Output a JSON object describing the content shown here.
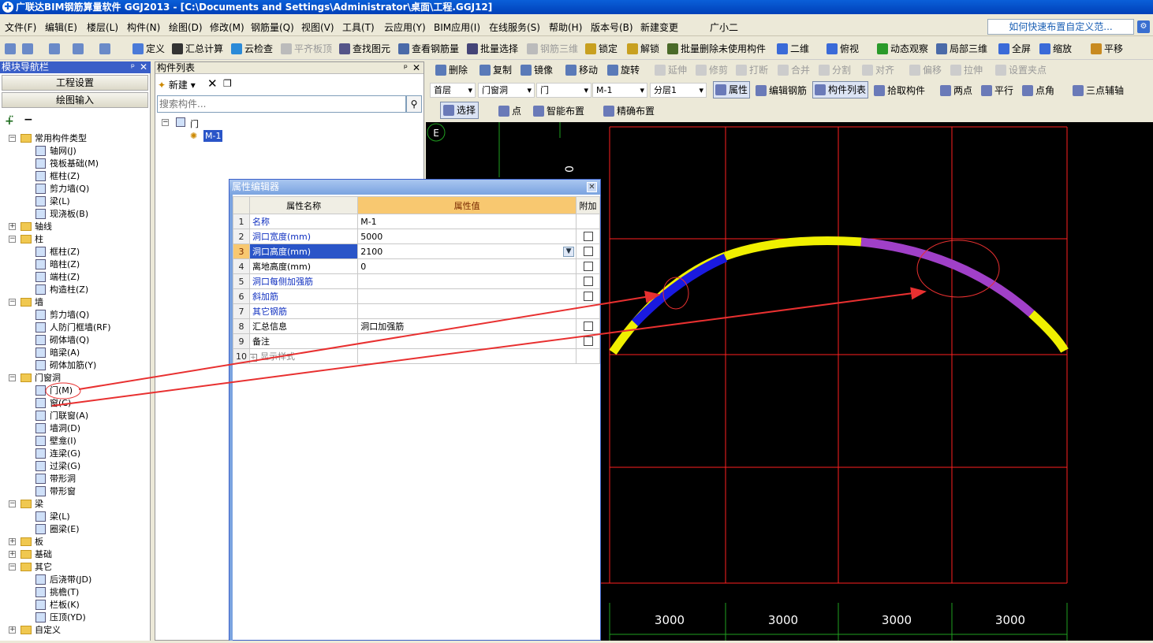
{
  "title_bar": {
    "text": "广联达BIM钢筋算量软件 GGJ2013 - [C:\\Documents and Settings\\Administrator\\桌面\\工程.GGJ12]"
  },
  "menu": [
    "文件(F)",
    "编辑(E)",
    "楼层(L)",
    "构件(N)",
    "绘图(D)",
    "修改(M)",
    "钢筋量(Q)",
    "视图(V)",
    "工具(T)",
    "云应用(Y)",
    "BIM应用(I)",
    "在线服务(S)",
    "帮助(H)",
    "版本号(B)",
    "新建变更",
    "广小二"
  ],
  "help_link": "如何快速布置自定义范...",
  "toolbar1": [
    "定义",
    "汇总计算",
    "云检查",
    "平齐板顶",
    "查找图元",
    "查看钢筋量",
    "批量选择",
    "钢筋三维",
    "锁定",
    "解锁",
    "批量删除未使用构件",
    "二维",
    "俯视",
    "动态观察",
    "局部三维",
    "全屏",
    "缩放",
    "平移"
  ],
  "toolbar2": [
    "删除",
    "复制",
    "镜像",
    "移动",
    "旋转",
    "延伸",
    "修剪",
    "打断",
    "合并",
    "分割",
    "对齐",
    "偏移",
    "拉伸",
    "设置夹点"
  ],
  "toolbar3": {
    "floor": "首层",
    "category": "门窗洞",
    "type": "门",
    "component": "M-1",
    "layer": "分层1",
    "btn_props": "属性",
    "btn_edit_rebar": "编辑钢筋",
    "btn_comp_list": "构件列表",
    "btn_pick": "拾取构件",
    "btn_two_point": "两点",
    "btn_parallel": "平行",
    "btn_point_angle": "点角",
    "btn_three_point": "三点辅轴"
  },
  "toolbar4": {
    "select": "选择",
    "point": "点",
    "smart": "智能布置",
    "precise": "精确布置"
  },
  "nav": {
    "header": "模块导航栏",
    "btn_project": "工程设置",
    "btn_draw": "绘图输入",
    "tree": [
      {
        "label": "常用构件类型",
        "lvl": 0,
        "exp": "-",
        "folder": true
      },
      {
        "label": "轴网(J)",
        "lvl": 1
      },
      {
        "label": "筏板基础(M)",
        "lvl": 1
      },
      {
        "label": "框柱(Z)",
        "lvl": 1
      },
      {
        "label": "剪力墙(Q)",
        "lvl": 1
      },
      {
        "label": "梁(L)",
        "lvl": 1
      },
      {
        "label": "现浇板(B)",
        "lvl": 1
      },
      {
        "label": "轴线",
        "lvl": 0,
        "exp": "+",
        "folder": true
      },
      {
        "label": "柱",
        "lvl": 0,
        "exp": "-",
        "folder": true
      },
      {
        "label": "框柱(Z)",
        "lvl": 1
      },
      {
        "label": "暗柱(Z)",
        "lvl": 1
      },
      {
        "label": "端柱(Z)",
        "lvl": 1
      },
      {
        "label": "构造柱(Z)",
        "lvl": 1
      },
      {
        "label": "墙",
        "lvl": 0,
        "exp": "-",
        "folder": true
      },
      {
        "label": "剪力墙(Q)",
        "lvl": 1
      },
      {
        "label": "人防门框墙(RF)",
        "lvl": 1
      },
      {
        "label": "砌体墙(Q)",
        "lvl": 1
      },
      {
        "label": "暗梁(A)",
        "lvl": 1
      },
      {
        "label": "砌体加筋(Y)",
        "lvl": 1
      },
      {
        "label": "门窗洞",
        "lvl": 0,
        "exp": "-",
        "folder": true
      },
      {
        "label": "门(M)",
        "lvl": 1
      },
      {
        "label": "窗(C)",
        "lvl": 1
      },
      {
        "label": "门联窗(A)",
        "lvl": 1
      },
      {
        "label": "墙洞(D)",
        "lvl": 1
      },
      {
        "label": "壁龛(I)",
        "lvl": 1
      },
      {
        "label": "连梁(G)",
        "lvl": 1
      },
      {
        "label": "过梁(G)",
        "lvl": 1
      },
      {
        "label": "带形洞",
        "lvl": 1
      },
      {
        "label": "带形窗",
        "lvl": 1
      },
      {
        "label": "梁",
        "lvl": 0,
        "exp": "-",
        "folder": true
      },
      {
        "label": "梁(L)",
        "lvl": 1
      },
      {
        "label": "圈梁(E)",
        "lvl": 1
      },
      {
        "label": "板",
        "lvl": 0,
        "exp": "+",
        "folder": true
      },
      {
        "label": "基础",
        "lvl": 0,
        "exp": "+",
        "folder": true
      },
      {
        "label": "其它",
        "lvl": 0,
        "exp": "-",
        "folder": true
      },
      {
        "label": "后浇带(JD)",
        "lvl": 1
      },
      {
        "label": "挑檐(T)",
        "lvl": 1
      },
      {
        "label": "栏板(K)",
        "lvl": 1
      },
      {
        "label": "压顶(YD)",
        "lvl": 1
      },
      {
        "label": "自定义",
        "lvl": 0,
        "exp": "+",
        "folder": true
      }
    ]
  },
  "comp_list": {
    "header": "构件列表",
    "new_label": "新建",
    "search_placeholder": "搜索构件...",
    "root": "门",
    "item": "M-1"
  },
  "prop_editor": {
    "title": "属性编辑器",
    "col_name": "属性名称",
    "col_value": "属性值",
    "col_add": "附加",
    "rows": [
      {
        "n": "1",
        "name": "名称",
        "value": "M-1",
        "blue": true,
        "chk": false
      },
      {
        "n": "2",
        "name": "洞口宽度(mm)",
        "value": "5000",
        "blue": true,
        "chk": true
      },
      {
        "n": "3",
        "name": "洞口高度(mm)",
        "value": "2100",
        "blue": true,
        "chk": true,
        "selected": true
      },
      {
        "n": "4",
        "name": "离地高度(mm)",
        "value": "0",
        "blue": false,
        "chk": true
      },
      {
        "n": "5",
        "name": "洞口每侧加强筋",
        "value": "",
        "blue": true,
        "chk": true
      },
      {
        "n": "6",
        "name": "斜加筋",
        "value": "",
        "blue": true,
        "chk": true
      },
      {
        "n": "7",
        "name": "其它钢筋",
        "value": "",
        "blue": true,
        "chk": false
      },
      {
        "n": "8",
        "name": "汇总信息",
        "value": "洞口加强筋",
        "blue": false,
        "chk": true
      },
      {
        "n": "9",
        "name": "备注",
        "value": "",
        "blue": false,
        "chk": true
      },
      {
        "n": "10",
        "name": "显示样式",
        "value": "",
        "blue": false,
        "chk": false,
        "plus": true
      }
    ]
  },
  "canvas": {
    "axis_label": "E",
    "dims": [
      "3000",
      "3000",
      "3000",
      "3000"
    ],
    "side_text": "0"
  },
  "colors": {
    "grid": "#ff2020",
    "arc_yellow": "#f0f000",
    "arc_blue": "#1a1ae0",
    "arc_purple": "#a040c8",
    "annotation": "#e83030"
  }
}
